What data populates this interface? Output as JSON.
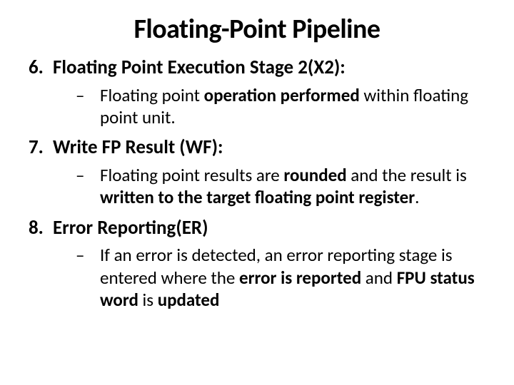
{
  "title": "Floating-Point Pipeline",
  "items": [
    {
      "num": "6.",
      "heading": "Floating Point Execution Stage 2(X2):",
      "sub": {
        "dash": "–",
        "pre": "Floating point ",
        "bold1": "operation performed",
        "mid": " within floating point unit.",
        "bold2": "",
        "mid2": "",
        "bold3": "",
        "post": ""
      }
    },
    {
      "num": "7.",
      "heading": "Write FP Result (WF):",
      "sub": {
        "dash": "–",
        "pre": "Floating point results are ",
        "bold1": "rounded ",
        "mid": "and the result is ",
        "bold2": "written to the target floating point register",
        "mid2": ".",
        "bold3": "",
        "post": ""
      }
    },
    {
      "num": "8.",
      "heading": "Error Reporting(ER)",
      "sub": {
        "dash": "–",
        "pre": "If an error is detected, an error reporting stage is entered where the ",
        "bold1": "error is reported",
        "mid": " and ",
        "bold2": "FPU status word ",
        "mid2": "is ",
        "bold3": "updated",
        "post": ""
      }
    }
  ]
}
